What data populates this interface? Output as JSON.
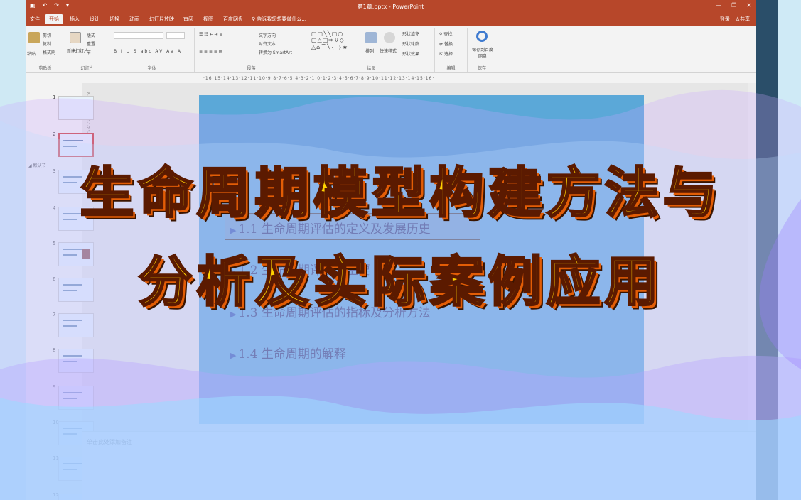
{
  "window": {
    "title": "第1章.pptx - PowerPoint",
    "quick_access": [
      "▣",
      "↶",
      "↷",
      "▾"
    ],
    "controls": [
      "—",
      "❐",
      "✕"
    ]
  },
  "tabs": [
    {
      "label": "文件"
    },
    {
      "label": "开始"
    },
    {
      "label": "插入"
    },
    {
      "label": "设计"
    },
    {
      "label": "切换"
    },
    {
      "label": "动画"
    },
    {
      "label": "幻灯片放映"
    },
    {
      "label": "审阅"
    },
    {
      "label": "视图"
    },
    {
      "label": "百度网盘"
    }
  ],
  "tell_me": "告诉我您想要做什么...",
  "account": {
    "login": "登录",
    "share": "共享"
  },
  "ribbon": {
    "clipboard": {
      "name": "剪贴板",
      "paste": "粘贴",
      "cut": "剪切",
      "copy": "复制",
      "format_painter": "格式刷"
    },
    "slides": {
      "name": "幻灯片",
      "new_slide": "新建幻灯片",
      "layout": "版式",
      "reset": "重置",
      "section": "节"
    },
    "font": {
      "name": "字体",
      "buttons": "B  I  U  S  abc  AV  Aa  A"
    },
    "paragraph": {
      "name": "段落",
      "text_direction": "文字方向",
      "align_text": "对齐文本",
      "smartart": "转换为 SmartArt"
    },
    "drawing": {
      "name": "绘图",
      "arrange": "排列",
      "quick_styles": "快速样式",
      "fill": "形状填充",
      "outline": "形状轮廓",
      "effects": "形状效果"
    },
    "editing": {
      "name": "编辑",
      "find": "查找",
      "replace": "替换",
      "select": "选择"
    },
    "save": {
      "name": "保存",
      "label": "保存到百度网盘"
    }
  },
  "ruler_h": "·16·15·14·13·12·11·10·9·8·7·6·5·4·3·2·1·0·1·2·3·4·5·6·7·8·9·10·11·12·13·14·15·16·",
  "ruler_v": "8·7·6·5·4·3·2·1·0·1·2·3·4·5·6·7·8",
  "sidebar": {
    "section_label": "默认节",
    "slide_numbers": [
      "1",
      "2",
      "3",
      "4",
      "5",
      "6",
      "7",
      "8",
      "9",
      "10",
      "11",
      "12"
    ]
  },
  "slide": {
    "bullets": [
      "1.1 生命周期评估的定义及发展历史",
      "1.2 生命周期评估的主要",
      "1.3 生命周期评估的指标及分析方法",
      "1.4 生命周期的解释"
    ]
  },
  "notes_placeholder": "单击此处添加备注",
  "headline": {
    "line1": "生命周期模型构建方法与",
    "line2": "分析及实际案例应用"
  },
  "colors": {
    "accent": "#b7472a",
    "headline_fill": "#ffd200",
    "headline_shadow": "#e35d06"
  }
}
